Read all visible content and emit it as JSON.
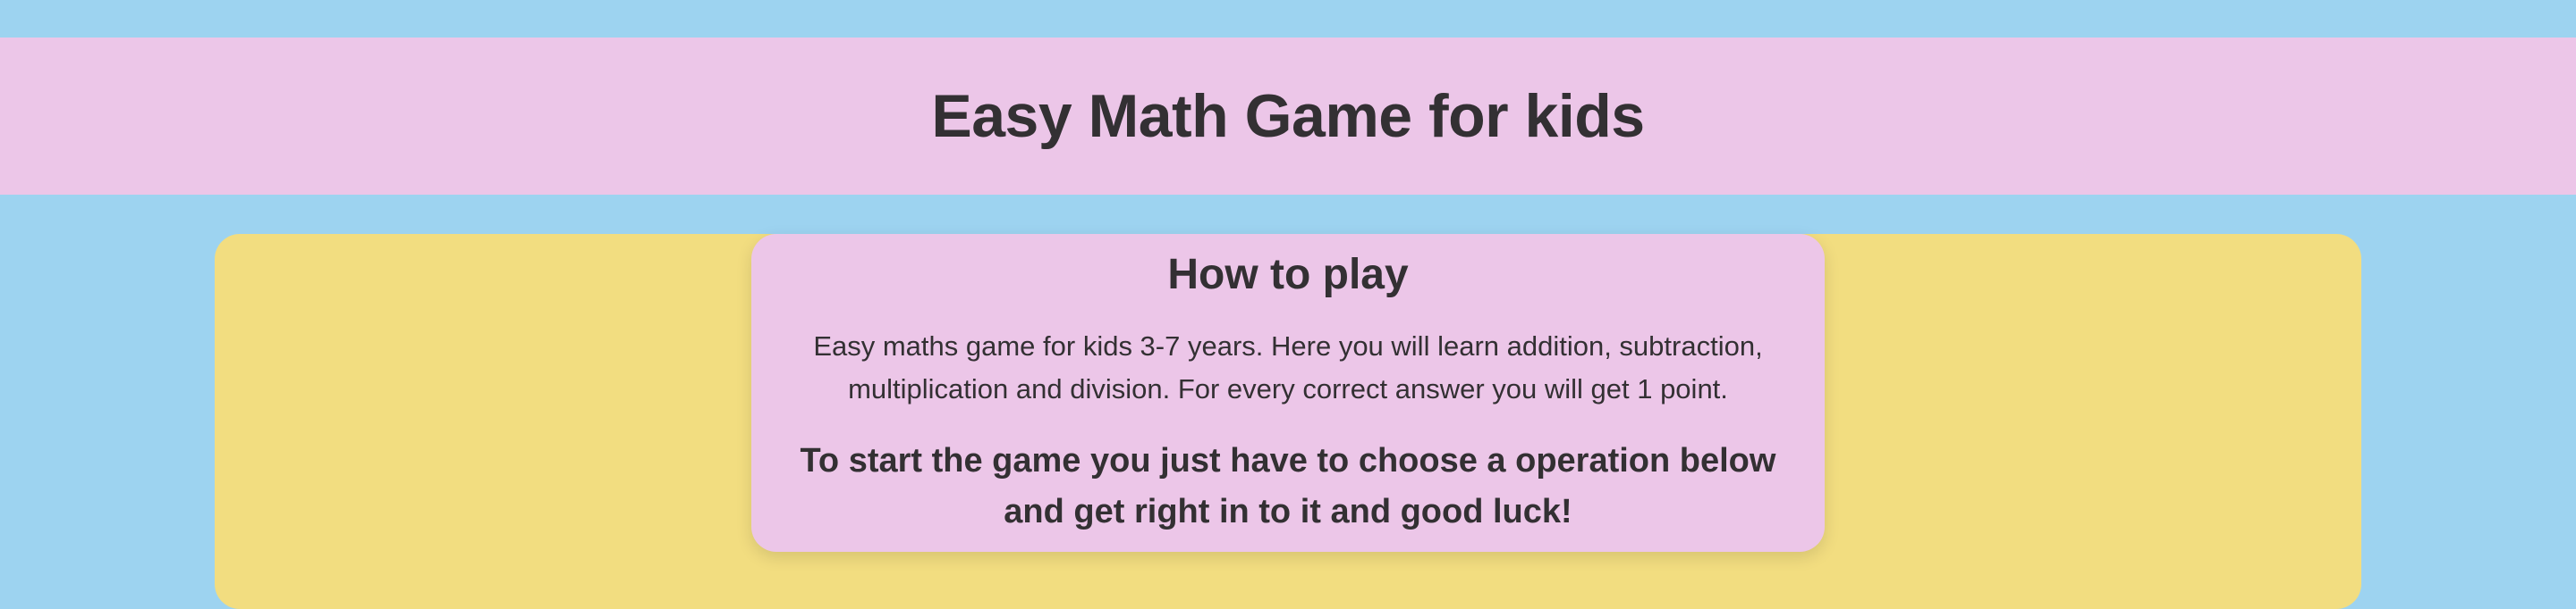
{
  "header": {
    "title": "Easy Math Game for kids"
  },
  "instructions": {
    "heading": "How to play",
    "description": "Easy maths game for kids 3-7 years. Here you will learn addition, subtraction, multiplication and division. For every correct answer you will get 1 point.",
    "call_to_action": "To start the game you just have to choose a operation below and get right in to it and good luck!"
  },
  "colors": {
    "background": "#9dd3f0",
    "header": "#ecc6e8",
    "panel": "#f2dd80",
    "card": "#ecc6e8",
    "text": "#333033"
  }
}
